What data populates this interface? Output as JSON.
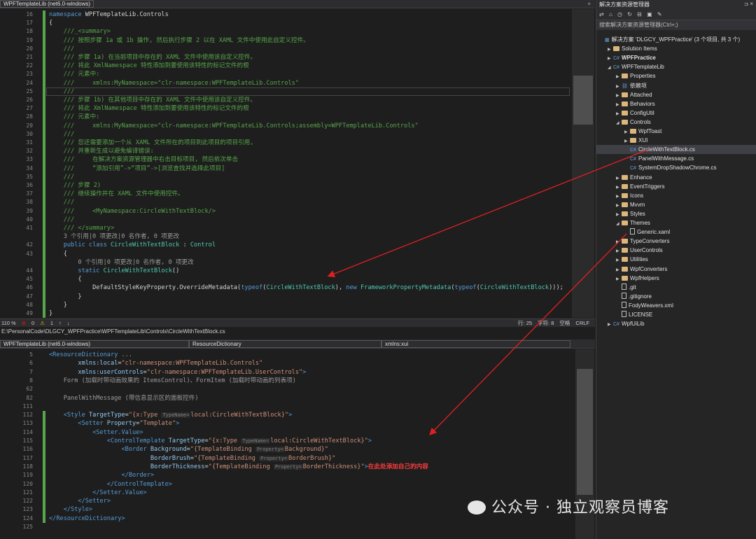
{
  "top_editor": {
    "project_tab": "WPFTemplateLib (net6.0-windows)",
    "lines": [
      {
        "n": "16",
        "parts": [
          [
            "kw",
            "namespace "
          ],
          [
            "tx",
            "WPFTemplateLib.Controls"
          ]
        ]
      },
      {
        "n": "17",
        "parts": [
          [
            "tx",
            "{"
          ]
        ]
      },
      {
        "n": "18",
        "parts": [
          [
            "cm",
            "    ///_<summary>"
          ]
        ]
      },
      {
        "n": "19",
        "parts": [
          [
            "cm",
            "    /// 按照步骤 1a 或 1b 操作, 然后执行步骤 2 以在 XAML 文件中使用此自定义控件。"
          ]
        ]
      },
      {
        "n": "20",
        "parts": [
          [
            "cm",
            "    ///"
          ]
        ]
      },
      {
        "n": "21",
        "parts": [
          [
            "cm",
            "    /// 步骤 1a) 在当前项目中存在的 XAML 文件中使用该自定义控件。"
          ]
        ]
      },
      {
        "n": "22",
        "parts": [
          [
            "cm",
            "    /// 将此 XmlNamespace 特性添加到要使用该特性的标记文件的根"
          ]
        ]
      },
      {
        "n": "23",
        "parts": [
          [
            "cm",
            "    /// 元素中:"
          ]
        ]
      },
      {
        "n": "24",
        "parts": [
          [
            "cm",
            "    ///     xmlns:MyNamespace=\"clr-namespace:WPFTemplateLib.Controls\""
          ]
        ]
      },
      {
        "n": "25",
        "parts": [
          [
            "cm",
            "    ///"
          ]
        ]
      },
      {
        "n": "26",
        "parts": [
          [
            "cm",
            "    /// 步骤 1b) 在其他项目中存在的 XAML 文件中使用该自定义控件。"
          ]
        ]
      },
      {
        "n": "27",
        "parts": [
          [
            "cm",
            "    /// 将此 XmlNamespace 特性添加到要使用该特性的标记文件的根"
          ]
        ]
      },
      {
        "n": "28",
        "parts": [
          [
            "cm",
            "    /// 元素中:"
          ]
        ]
      },
      {
        "n": "29",
        "parts": [
          [
            "cm",
            "    ///     xmlns:MyNamespace=\"clr-namespace:WPFTemplateLib.Controls;assembly=WPFTemplateLib.Controls\""
          ]
        ]
      },
      {
        "n": "30",
        "parts": [
          [
            "cm",
            "    ///"
          ]
        ]
      },
      {
        "n": "31",
        "parts": [
          [
            "cm",
            "    /// 您还需要添加一个从 XAML 文件所在的项目到此项目的项目引用,"
          ]
        ]
      },
      {
        "n": "32",
        "parts": [
          [
            "cm",
            "    /// 并重新生成以避免编译错误:"
          ]
        ]
      },
      {
        "n": "33",
        "parts": [
          [
            "cm",
            "    ///     在解决方案资源管理器中右击目标项目, 然后依次单击"
          ]
        ]
      },
      {
        "n": "34",
        "parts": [
          [
            "cm",
            "    ///     “添加引用”->“项目”->[浏览查找并选择此项目]"
          ]
        ]
      },
      {
        "n": "35",
        "parts": [
          [
            "cm",
            "    ///"
          ]
        ]
      },
      {
        "n": "36",
        "parts": [
          [
            "cm",
            "    /// 步骤 2)"
          ]
        ]
      },
      {
        "n": "37",
        "parts": [
          [
            "cm",
            "    /// 继续操作并在 XAML 文件中使用控件。"
          ]
        ]
      },
      {
        "n": "38",
        "parts": [
          [
            "cm",
            "    ///"
          ]
        ]
      },
      {
        "n": "39",
        "parts": [
          [
            "cm",
            "    ///     <MyNamespace:CircleWithTextBlock/>"
          ]
        ]
      },
      {
        "n": "40",
        "parts": [
          [
            "cm",
            "    ///"
          ]
        ]
      },
      {
        "n": "41",
        "parts": [
          [
            "cm",
            "    /// </summary>"
          ]
        ]
      },
      {
        "n": "",
        "parts": [
          [
            "gr",
            "    3 个引用|0 项更改|0 名作者, 0 项更改"
          ]
        ]
      },
      {
        "n": "42",
        "parts": [
          [
            "kw",
            "    public class "
          ],
          [
            "ty",
            "CircleWithTextBlock"
          ],
          [
            "tx",
            " : "
          ],
          [
            "ty",
            "Control"
          ]
        ]
      },
      {
        "n": "43",
        "parts": [
          [
            "tx",
            "    {"
          ]
        ]
      },
      {
        "n": "",
        "parts": [
          [
            "gr",
            "        0 个引用|0 项更改|0 名作者, 0 项更改"
          ]
        ]
      },
      {
        "n": "44",
        "parts": [
          [
            "kw",
            "        static "
          ],
          [
            "ty",
            "CircleWithTextBlock"
          ],
          [
            "tx",
            "()"
          ]
        ]
      },
      {
        "n": "45",
        "parts": [
          [
            "tx",
            "        {"
          ]
        ]
      },
      {
        "n": "46",
        "parts": [
          [
            "tx",
            "            DefaultStyleKeyProperty.OverrideMetadata("
          ],
          [
            "kw",
            "typeof"
          ],
          [
            "tx",
            "("
          ],
          [
            "ty",
            "CircleWithTextBlock"
          ],
          [
            "tx",
            "), "
          ],
          [
            "kw",
            "new "
          ],
          [
            "ty",
            "FrameworkPropertyMetadata"
          ],
          [
            "tx",
            "("
          ],
          [
            "kw",
            "typeof"
          ],
          [
            "tx",
            "("
          ],
          [
            "ty",
            "CircleWithTextBlock"
          ],
          [
            "tx",
            ")));"
          ]
        ]
      },
      {
        "n": "47",
        "parts": [
          [
            "tx",
            "        }"
          ]
        ]
      },
      {
        "n": "48",
        "parts": [
          [
            "tx",
            "    }"
          ]
        ]
      },
      {
        "n": "49",
        "parts": [
          [
            "tx",
            "}"
          ]
        ]
      }
    ],
    "status": {
      "zoom": "110 %",
      "errors": "0",
      "warnings": "1",
      "line": "行: 25",
      "col": "字符: 8",
      "spaces": "空格",
      "crlf": "CRLF"
    }
  },
  "path_bar": "E:\\PersonalCode\\DLGCY_WPFPractice\\WPFTemplateLib\\Controls\\CircleWithTextBlock.cs",
  "bottom_editor": {
    "project_tab": "WPFTemplateLib (net6.0-windows)",
    "scope_tab": "ResourceDictionary",
    "xmlns_tab": "xmlns:xui",
    "lines": [
      {
        "n": "5",
        "parts": [
          [
            "xt",
            "<ResourceDictionary"
          ],
          [
            "gr",
            " ..."
          ]
        ]
      },
      {
        "n": "6",
        "parts": [
          [
            "xa",
            "        xmlns:local"
          ],
          [
            "tx",
            "="
          ],
          [
            "xs",
            "\"clr-namespace:WPFTemplateLib.Controls\""
          ]
        ]
      },
      {
        "n": "7",
        "parts": [
          [
            "xa",
            "        xmlns:userControls"
          ],
          [
            "tx",
            "="
          ],
          [
            "xs",
            "\"clr-namespace:WPFTemplateLib.UserControls\""
          ],
          [
            "xt",
            ">"
          ]
        ]
      },
      {
        "n": "8",
        "parts": [
          [
            "gr",
            "    Form (加载时带动画效果的 ItemsControl)、FormItem (加载时带动画的列表项)"
          ]
        ]
      },
      {
        "n": "62",
        "parts": []
      },
      {
        "n": "82",
        "parts": [
          [
            "gr",
            "    PanelWithMessage (带信息显示区的面板控件)"
          ]
        ]
      },
      {
        "n": "111",
        "parts": []
      },
      {
        "n": "112",
        "parts": [
          [
            "xt",
            "    <Style "
          ],
          [
            "xa",
            "TargetType"
          ],
          [
            "tx",
            "="
          ],
          [
            "xs",
            "\"{x:Type "
          ],
          [
            "hint",
            "TypeName="
          ],
          [
            "xs",
            "local:CircleWithTextBlock}\""
          ],
          [
            "xt",
            ">"
          ]
        ]
      },
      {
        "n": "113",
        "parts": [
          [
            "xt",
            "        <Setter "
          ],
          [
            "xa",
            "Property"
          ],
          [
            "tx",
            "="
          ],
          [
            "xs",
            "\"Template\""
          ],
          [
            "xt",
            ">"
          ]
        ]
      },
      {
        "n": "114",
        "parts": [
          [
            "xt",
            "            <Setter.Value>"
          ]
        ]
      },
      {
        "n": "115",
        "parts": [
          [
            "xt",
            "                <ControlTemplate "
          ],
          [
            "xa",
            "TargetType"
          ],
          [
            "tx",
            "="
          ],
          [
            "xs",
            "\"{x:Type "
          ],
          [
            "hint",
            "TypeName="
          ],
          [
            "xs",
            "local:CircleWithTextBlock}\""
          ],
          [
            "xt",
            ">"
          ]
        ]
      },
      {
        "n": "116",
        "parts": [
          [
            "xt",
            "                    <Border "
          ],
          [
            "xa",
            "Background"
          ],
          [
            "tx",
            "="
          ],
          [
            "xs",
            "\"{TemplateBinding "
          ],
          [
            "hint",
            "Property="
          ],
          [
            "xs",
            "Background}\""
          ]
        ]
      },
      {
        "n": "117",
        "parts": [
          [
            "xa",
            "                            BorderBrush"
          ],
          [
            "tx",
            "="
          ],
          [
            "xs",
            "\"{TemplateBinding "
          ],
          [
            "hint",
            "Property="
          ],
          [
            "xs",
            "BorderBrush}\""
          ]
        ]
      },
      {
        "n": "118",
        "parts": [
          [
            "xa",
            "                            BorderThickness"
          ],
          [
            "tx",
            "="
          ],
          [
            "xs",
            "\"{TemplateBinding "
          ],
          [
            "hint",
            "Property="
          ],
          [
            "xs",
            "BorderThickness}\""
          ],
          [
            "xt",
            ">"
          ],
          [
            "red",
            "在此处添加自己的内容"
          ]
        ]
      },
      {
        "n": "119",
        "parts": [
          [
            "xt",
            "                    </Border>"
          ]
        ]
      },
      {
        "n": "120",
        "parts": [
          [
            "xt",
            "                </ControlTemplate>"
          ]
        ]
      },
      {
        "n": "121",
        "parts": [
          [
            "xt",
            "            </Setter.Value>"
          ]
        ]
      },
      {
        "n": "122",
        "parts": [
          [
            "xt",
            "        </Setter>"
          ]
        ]
      },
      {
        "n": "123",
        "parts": [
          [
            "xt",
            "    </Style>"
          ]
        ]
      },
      {
        "n": "124",
        "parts": [
          [
            "xt",
            "</ResourceDictionary>"
          ]
        ]
      },
      {
        "n": "125",
        "parts": []
      }
    ]
  },
  "solution_explorer": {
    "title": "解决方案资源管理器",
    "search_placeholder": "搜索解决方案资源管理器(Ctrl+;)",
    "items": [
      {
        "label": "解决方案 'DLGCY_WPFPractice' (3 个项目, 共 3 个)",
        "kind": "solution",
        "indent": 0,
        "exp": ""
      },
      {
        "label": "Solution Items",
        "kind": "folder",
        "indent": 1,
        "exp": "▶"
      },
      {
        "label": "WPFPractice",
        "kind": "project",
        "indent": 1,
        "exp": "▶",
        "bold": true
      },
      {
        "label": "WPFTemplateLib",
        "kind": "project",
        "indent": 1,
        "exp": "◢"
      },
      {
        "label": "Properties",
        "kind": "folder",
        "indent": 2,
        "exp": "▶"
      },
      {
        "label": "依赖项",
        "kind": "deps",
        "indent": 2,
        "exp": "▶"
      },
      {
        "label": "Attached",
        "kind": "folder",
        "indent": 2,
        "exp": "▶"
      },
      {
        "label": "Behaviors",
        "kind": "folder",
        "indent": 2,
        "exp": "▶"
      },
      {
        "label": "ConfigUtil",
        "kind": "folder",
        "indent": 2,
        "exp": "▶"
      },
      {
        "label": "Controls",
        "kind": "folder",
        "indent": 2,
        "exp": "◢"
      },
      {
        "label": "WpfToast",
        "kind": "folder",
        "indent": 3,
        "exp": "▶"
      },
      {
        "label": "XUI",
        "kind": "folder",
        "indent": 3,
        "exp": "▶"
      },
      {
        "label": "CircleWithTextBlock.cs",
        "kind": "cs",
        "indent": 3,
        "exp": "",
        "selected": true
      },
      {
        "label": "PanelWithMessage.cs",
        "kind": "cs",
        "indent": 3,
        "exp": ""
      },
      {
        "label": "SystemDropShadowChrome.cs",
        "kind": "cs",
        "indent": 3,
        "exp": ""
      },
      {
        "label": "Enhance",
        "kind": "folder",
        "indent": 2,
        "exp": "▶"
      },
      {
        "label": "EventTriggers",
        "kind": "folder",
        "indent": 2,
        "exp": "▶"
      },
      {
        "label": "Icons",
        "kind": "folder",
        "indent": 2,
        "exp": "▶"
      },
      {
        "label": "Mvvm",
        "kind": "folder",
        "indent": 2,
        "exp": "▶"
      },
      {
        "label": "Styles",
        "kind": "folder",
        "indent": 2,
        "exp": "▶"
      },
      {
        "label": "Themes",
        "kind": "folder",
        "indent": 2,
        "exp": "◢"
      },
      {
        "label": "Generic.xaml",
        "kind": "file",
        "indent": 3,
        "exp": ""
      },
      {
        "label": "TypeConverters",
        "kind": "folder",
        "indent": 2,
        "exp": "▶"
      },
      {
        "label": "UserControls",
        "kind": "folder",
        "indent": 2,
        "exp": "▶"
      },
      {
        "label": "Utilities",
        "kind": "folder",
        "indent": 2,
        "exp": "▶"
      },
      {
        "label": "WpfConverters",
        "kind": "folder",
        "indent": 2,
        "exp": "▶"
      },
      {
        "label": "WpfHelpers",
        "kind": "folder",
        "indent": 2,
        "exp": "▶"
      },
      {
        "label": ".git",
        "kind": "file",
        "indent": 2,
        "exp": ""
      },
      {
        "label": ".gitignore",
        "kind": "file",
        "indent": 2,
        "exp": ""
      },
      {
        "label": "FodyWeavers.xml",
        "kind": "file",
        "indent": 2,
        "exp": ""
      },
      {
        "label": "LICENSE",
        "kind": "file",
        "indent": 2,
        "exp": ""
      },
      {
        "label": "WpfUiLib",
        "kind": "project",
        "indent": 1,
        "exp": "▶"
      }
    ]
  },
  "watermark": "公众号 · 独立观察员博客",
  "colors": {
    "accent_arrow": "#e02020",
    "change_bar": "#57a64a"
  }
}
